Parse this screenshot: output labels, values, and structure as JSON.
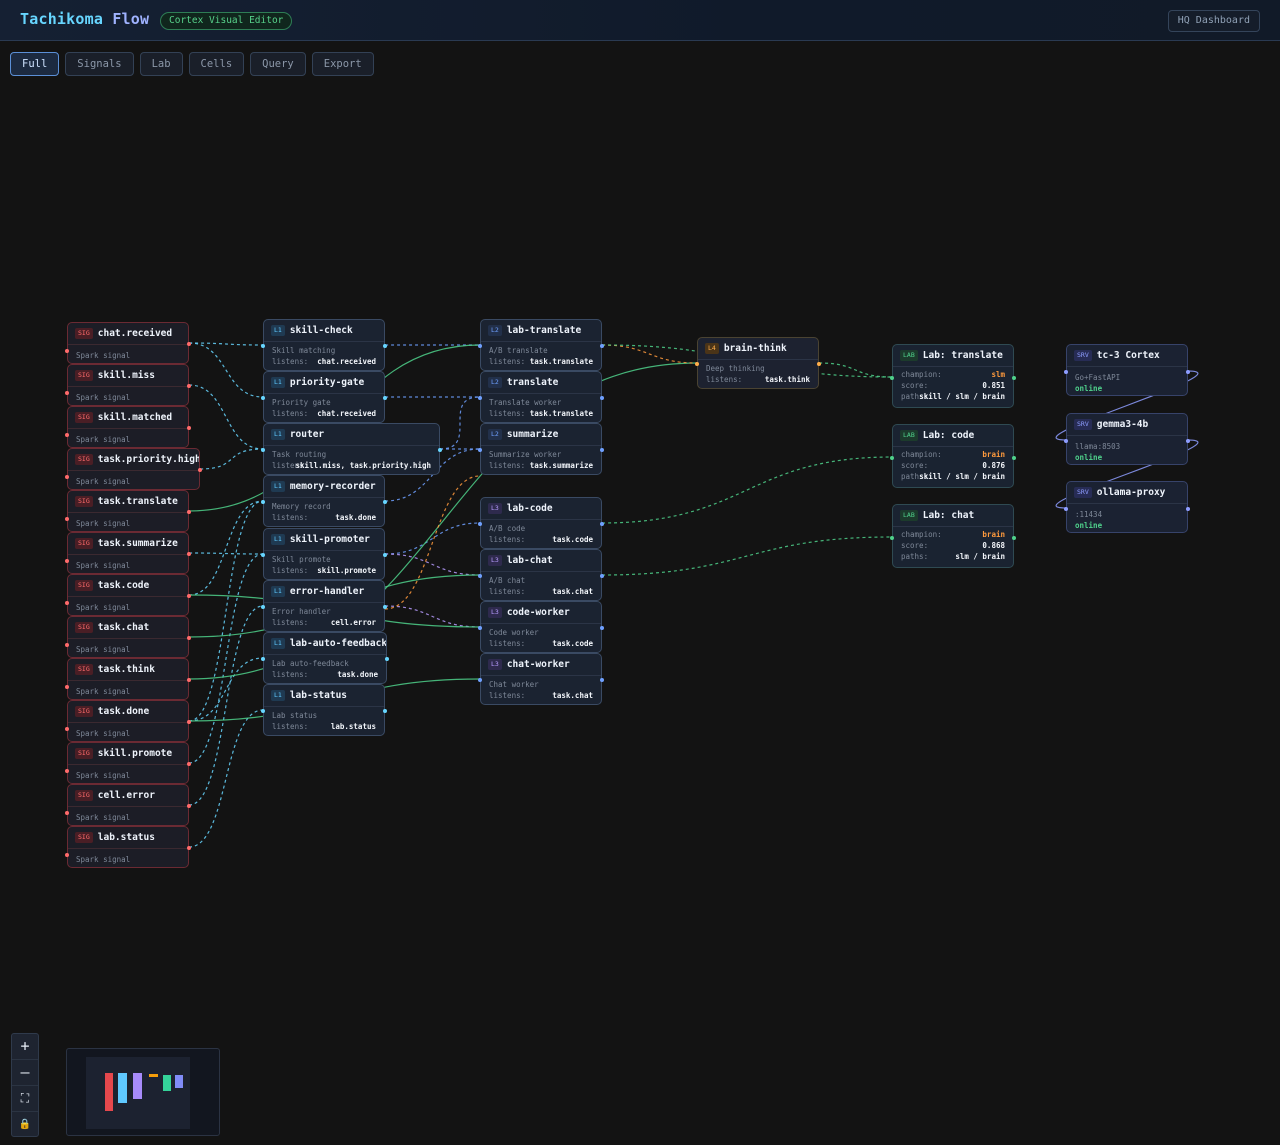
{
  "header": {
    "brand_main": "Tachikoma",
    "brand_sub": "Flow",
    "badge": "Cortex Visual Editor",
    "hq_button": "HQ Dashboard"
  },
  "tabs": [
    {
      "label": "Full",
      "active": true
    },
    {
      "label": "Signals"
    },
    {
      "label": "Lab"
    },
    {
      "label": "Cells"
    },
    {
      "label": "Query"
    },
    {
      "label": "Export"
    }
  ],
  "signals": [
    {
      "tag": "SIG",
      "name": "chat.received",
      "desc": "Spark signal"
    },
    {
      "tag": "SIG",
      "name": "skill.miss",
      "desc": "Spark signal"
    },
    {
      "tag": "SIG",
      "name": "skill.matched",
      "desc": "Spark signal"
    },
    {
      "tag": "SIG",
      "name": "task.priority.high",
      "desc": "Spark signal"
    },
    {
      "tag": "SIG",
      "name": "task.translate",
      "desc": "Spark signal"
    },
    {
      "tag": "SIG",
      "name": "task.summarize",
      "desc": "Spark signal"
    },
    {
      "tag": "SIG",
      "name": "task.code",
      "desc": "Spark signal"
    },
    {
      "tag": "SIG",
      "name": "task.chat",
      "desc": "Spark signal"
    },
    {
      "tag": "SIG",
      "name": "task.think",
      "desc": "Spark signal"
    },
    {
      "tag": "SIG",
      "name": "task.done",
      "desc": "Spark signal"
    },
    {
      "tag": "SIG",
      "name": "skill.promote",
      "desc": "Spark signal"
    },
    {
      "tag": "SIG",
      "name": "cell.error",
      "desc": "Spark signal"
    },
    {
      "tag": "SIG",
      "name": "lab.status",
      "desc": "Spark signal"
    }
  ],
  "l1_cells": [
    {
      "tag": "L1",
      "name": "skill-check",
      "desc": "Skill matching",
      "listens_label": "listens:",
      "listens": "chat.received"
    },
    {
      "tag": "L1",
      "name": "priority-gate",
      "desc": "Priority gate",
      "listens_label": "listens:",
      "listens": "chat.received"
    },
    {
      "tag": "L1",
      "name": "router",
      "desc": "Task routing",
      "listens_label": "listens:",
      "listens": "skill.miss, task.priority.high"
    },
    {
      "tag": "L1",
      "name": "memory-recorder",
      "desc": "Memory record",
      "listens_label": "listens:",
      "listens": "task.done"
    },
    {
      "tag": "L1",
      "name": "skill-promoter",
      "desc": "Skill promote",
      "listens_label": "listens:",
      "listens": "skill.promote"
    },
    {
      "tag": "L1",
      "name": "error-handler",
      "desc": "Error handler",
      "listens_label": "listens:",
      "listens": "cell.error"
    },
    {
      "tag": "L1",
      "name": "lab-auto-feedback",
      "desc": "Lab auto-feedback",
      "listens_label": "listens:",
      "listens": "task.done"
    },
    {
      "tag": "L1",
      "name": "lab-status",
      "desc": "Lab status",
      "listens_label": "listens:",
      "listens": "lab.status"
    }
  ],
  "workers": [
    {
      "tag": "L2",
      "name": "lab-translate",
      "desc": "A/B translate",
      "listens_label": "listens:",
      "listens": "task.translate"
    },
    {
      "tag": "L2",
      "name": "translate",
      "desc": "Translate worker",
      "listens_label": "listens:",
      "listens": "task.translate"
    },
    {
      "tag": "L2",
      "name": "summarize",
      "desc": "Summarize worker",
      "listens_label": "listens:",
      "listens": "task.summarize"
    },
    {
      "tag": "L3",
      "name": "lab-code",
      "desc": "A/B code",
      "listens_label": "listens:",
      "listens": "task.code"
    },
    {
      "tag": "L3",
      "name": "lab-chat",
      "desc": "A/B chat",
      "listens_label": "listens:",
      "listens": "task.chat"
    },
    {
      "tag": "L3",
      "name": "code-worker",
      "desc": "Code worker",
      "listens_label": "listens:",
      "listens": "task.code"
    },
    {
      "tag": "L3",
      "name": "chat-worker",
      "desc": "Chat worker",
      "listens_label": "listens:",
      "listens": "task.chat"
    }
  ],
  "brain": {
    "tag": "L4",
    "name": "brain-think",
    "desc": "Deep thinking",
    "listens_label": "listens:",
    "listens": "task.think"
  },
  "labs": [
    {
      "tag": "LAB",
      "name": "Lab: translate",
      "champion_label": "champion:",
      "champion": "slm",
      "score_label": "score:",
      "score": "0.851",
      "paths_label": "paths:",
      "paths": "skill / slm / brain"
    },
    {
      "tag": "LAB",
      "name": "Lab: code",
      "champion_label": "champion:",
      "champion": "brain",
      "score_label": "score:",
      "score": "0.876",
      "paths_label": "paths:",
      "paths": "skill / slm / brain"
    },
    {
      "tag": "LAB",
      "name": "Lab: chat",
      "champion_label": "champion:",
      "champion": "brain",
      "score_label": "score:",
      "score": "0.868",
      "paths_label": "paths:",
      "paths": "slm / brain"
    }
  ],
  "servers": [
    {
      "tag": "SRV",
      "name": "tc-3 Cortex",
      "detail": "Go+FastAPI",
      "status": "online"
    },
    {
      "tag": "SRV",
      "name": "gemma3-4b",
      "detail": "llama:8503",
      "status": "online"
    },
    {
      "tag": "SRV",
      "name": "ollama-proxy",
      "detail": ":11434",
      "status": "online"
    }
  ],
  "controls": [
    {
      "icon": "plus-icon",
      "glyph": "+"
    },
    {
      "icon": "minus-icon",
      "glyph": "—"
    },
    {
      "icon": "fit-view-icon",
      "glyph": "⛶"
    },
    {
      "icon": "lock-icon",
      "glyph": "🔒"
    }
  ],
  "colors": {
    "signal": "#ff6b6b",
    "l1": "#5fc9ff",
    "l2": "#6fa0ff",
    "l3": "#b79cff",
    "l4": "#ffae4a",
    "lab": "#4fd18b",
    "server": "#8e9dff",
    "edge_green": "#4fd18b",
    "edge_cyan": "#67d6ff",
    "edge_orange": "#ff9a3d"
  }
}
